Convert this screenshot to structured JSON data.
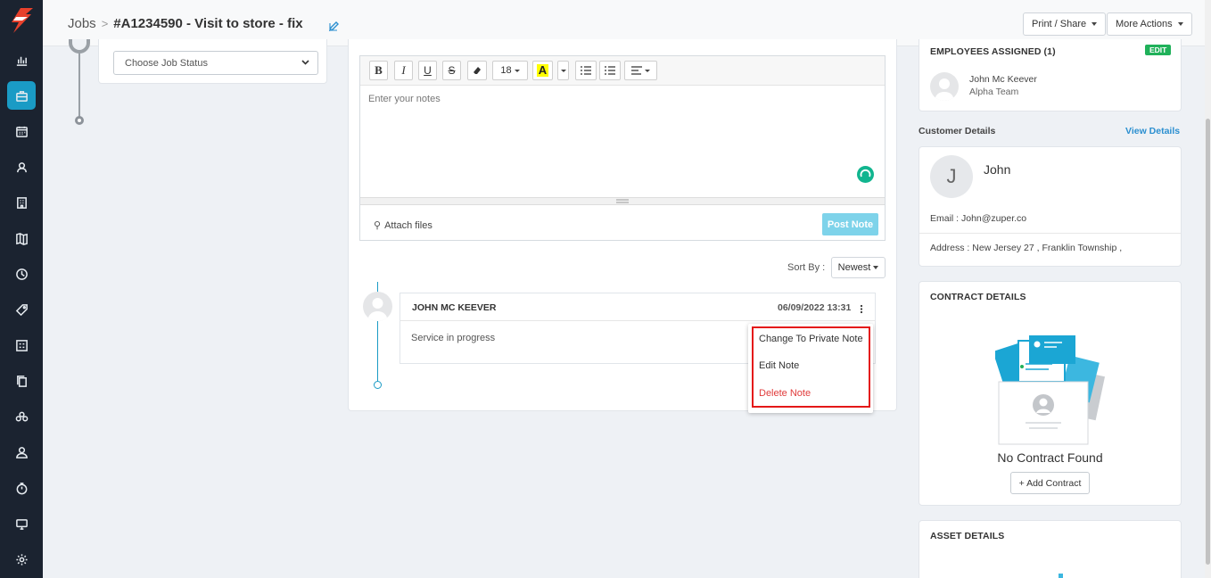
{
  "breadcrumb": {
    "root": "Jobs",
    "separator": ">",
    "title": "#A1234590 - Visit to store - fix"
  },
  "header_actions": {
    "print_share": "Print / Share",
    "more_actions": "More Actions"
  },
  "status_select": {
    "value": "Choose Job Status"
  },
  "editor": {
    "font_size": "18",
    "placeholder": "Enter your notes",
    "attach_label": "Attach files",
    "post_label": "Post Note",
    "toolbar": {
      "bold": "B",
      "italic": "I",
      "underline": "U",
      "strike": "S"
    }
  },
  "sort": {
    "label": "Sort By :",
    "value": "Newest"
  },
  "note": {
    "author": "JOHN MC KEEVER",
    "timestamp": "06/09/2022 13:31",
    "body": "Service in progress"
  },
  "note_menu": {
    "items": [
      "Change To Private Note",
      "Edit Note",
      "Delete Note"
    ]
  },
  "employees": {
    "heading": "EMPLOYEES ASSIGNED (1)",
    "edit_label": "EDIT",
    "name": "John Mc Keever",
    "team": "Alpha Team"
  },
  "customer": {
    "section_label": "Customer Details",
    "view_link": "View Details",
    "initial": "J",
    "name": "John",
    "email": "Email : John@zuper.co",
    "address": "Address : New Jersey 27 , Franklin Township ,"
  },
  "contract": {
    "heading": "CONTRACT DETAILS",
    "empty_text": "No Contract Found",
    "add_label": "+ Add Contract"
  },
  "asset": {
    "heading": "ASSET DETAILS"
  },
  "sidebar": {
    "items": [
      "chart-icon",
      "briefcase-icon",
      "calendar-icon",
      "customers-icon",
      "building-icon",
      "map-icon",
      "clock-icon",
      "tag-icon",
      "form-icon",
      "copy-icon",
      "team-icon",
      "user-icon",
      "timer-icon",
      "monitor-icon",
      "settings-icon"
    ],
    "active": "briefcase-icon"
  },
  "colors": {
    "sidebar": "#1b2330",
    "accent": "#1a9bc5",
    "post_button": "#7ed3ea",
    "danger": "#e03b3b",
    "edit_badge": "#20b15a"
  }
}
